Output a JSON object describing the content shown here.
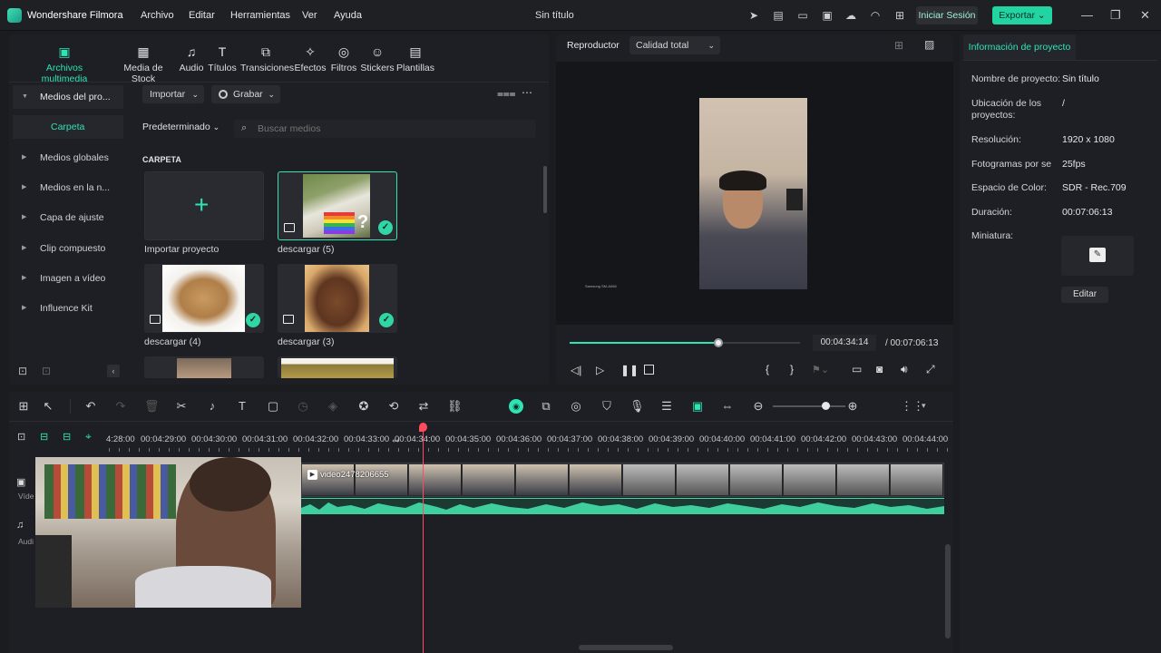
{
  "app": {
    "name": "Wondershare Filmora",
    "doc_title": "Sin título",
    "login_label": "Iniciar Sesión",
    "export_label": "Exportar"
  },
  "menu": [
    "Archivo",
    "Editar",
    "Herramientas",
    "Ver",
    "Ayuda"
  ],
  "categories": [
    {
      "label": "Archivos multimedia",
      "icon": "media-icon",
      "active": true
    },
    {
      "label": "Media de Stock",
      "icon": "stock-icon"
    },
    {
      "label": "Audio",
      "icon": "music-note-icon"
    },
    {
      "label": "Títulos",
      "icon": "text-icon"
    },
    {
      "label": "Transiciones",
      "icon": "transition-icon"
    },
    {
      "label": "Efectos",
      "icon": "effects-icon"
    },
    {
      "label": "Filtros",
      "icon": "filter-icon"
    },
    {
      "label": "Stickers",
      "icon": "sticker-icon"
    },
    {
      "label": "Plantillas",
      "icon": "template-icon"
    }
  ],
  "sidebar": {
    "project_media": "Medios del pro...",
    "folder": "Carpeta",
    "items": [
      "Medios globales",
      "Medios en la n...",
      "Capa de ajuste",
      "Clip compuesto",
      "Imagen a vídeo",
      "Influence Kit"
    ]
  },
  "media_toolbar": {
    "import": "Importar",
    "record": "Grabar",
    "sort": "Predeterminado",
    "search_placeholder": "Buscar medios",
    "section": "CARPETA"
  },
  "media_items": [
    {
      "label": "Importar proyecto"
    },
    {
      "label": "descargar (5)"
    },
    {
      "label": "descargar (4)"
    },
    {
      "label": "descargar (3)"
    }
  ],
  "player": {
    "tab": "Reproductor",
    "quality": "Calidad total",
    "watermark": "Samsung SM-A066",
    "progress": 0.645,
    "current_time": "00:04:34:14",
    "total_time": "/ 00:07:06:13"
  },
  "info": {
    "tab": "Información de proyecto",
    "rows": [
      {
        "label": "Nombre de proyecto:",
        "value": "Sin título"
      },
      {
        "label": "Ubicación de los proyectos:",
        "value": "/"
      },
      {
        "label": "Resolución:",
        "value": "1920 x 1080"
      },
      {
        "label": "Fotogramas por seg",
        "value": "25fps"
      },
      {
        "label": "Espacio de Color:",
        "value": "SDR - Rec.709"
      },
      {
        "label": "Duración:",
        "value": "00:07:06:13"
      },
      {
        "label": "Miniatura:",
        "value": ""
      }
    ],
    "edit_label": "Editar"
  },
  "timeline": {
    "ticks": [
      "4:28:00",
      "00:04:29:00",
      "00:04:30:00",
      "00:04:31:00",
      "00:04:32:00",
      "00:04:33:00",
      "00:04:34:00",
      "00:04:35:00",
      "00:04:36:00",
      "00:04:37:00",
      "00:04:38:00",
      "00:04:39:00",
      "00:04:40:00",
      "00:04:41:00",
      "00:04:42:00",
      "00:04:43:00",
      "00:04:44:00"
    ],
    "clip_name": "video2478206655",
    "video_track": "Víde",
    "audio_track": "Audi",
    "zoom_level": 0.72
  }
}
